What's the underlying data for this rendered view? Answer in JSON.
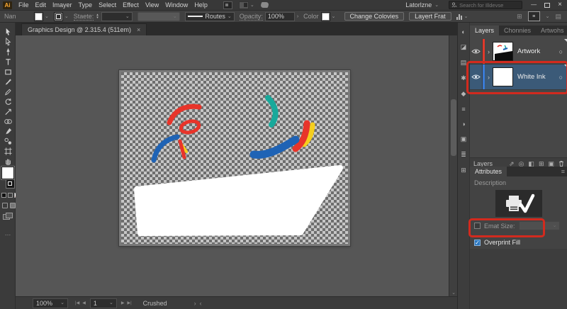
{
  "window": {
    "logo": "Ai",
    "workspace": "Latorlzne",
    "search_placeholder": "Search for Illdevse",
    "doc_tab": "Graphics Design @ 2.315.4 (511em)"
  },
  "menubar": {
    "items": [
      "File",
      "Edit",
      "Imayer",
      "Type",
      "Select",
      "Effect",
      "View",
      "Window",
      "Help"
    ]
  },
  "controlbar": {
    "selection_label": "Nan",
    "stroke_label": "Staete:",
    "stroke_style_value": "Routes",
    "opacity_label": "Opacity:",
    "opacity_value": "100%",
    "color_label": "Color",
    "change_colonies_button": "Change Colovies",
    "layert_frat_button": "Layert Frat"
  },
  "layers_panel": {
    "tabs": [
      "Layers",
      "Chonnies",
      "Artwohs"
    ],
    "rows": [
      {
        "name": "Artwork",
        "color": "#e0392b"
      },
      {
        "name": "White Ink",
        "color": "#3a7bd5"
      }
    ],
    "footer_label": "Layers"
  },
  "attributes_panel": {
    "tab": "Attributes",
    "description_label": "Description",
    "email_size_label": "Emat Size:",
    "overprint_label": "Overprint Fill"
  },
  "statusbar": {
    "zoom": "100%",
    "artboard_number": "1",
    "status_text": "Crushed"
  },
  "artwork_colors": {
    "red": "#e8342a",
    "blue": "#1f63b5",
    "teal": "#18a99b",
    "yellow": "#f5ce1e",
    "white": "#ffffff"
  },
  "ui_colors": {
    "annotation_red": "#d22a1e",
    "selection_blue": "#3b5a78",
    "checker_light": "#c6c6c6",
    "checker_dark": "#6e6e6e",
    "logo_orange": "#ffab33"
  },
  "icons": {
    "chevron_down": "⌄",
    "chevron_right": "›",
    "chevron_left": "‹",
    "panel_menu": "≡",
    "grid": "⊞",
    "list": "▤",
    "target": "○",
    "ellipsis": "…",
    "close": "×",
    "minimize": "—",
    "prev": "◀",
    "next": "▶",
    "bar": "|",
    "up": "▴",
    "down": "▾",
    "strip": [
      "◐",
      "◪",
      "▤",
      "✱",
      "◆",
      "≡",
      "◑",
      "▣",
      "≣",
      "⊞"
    ],
    "layers_footer": [
      "⇗",
      "◎",
      "◧",
      "⊞",
      "▣"
    ]
  }
}
